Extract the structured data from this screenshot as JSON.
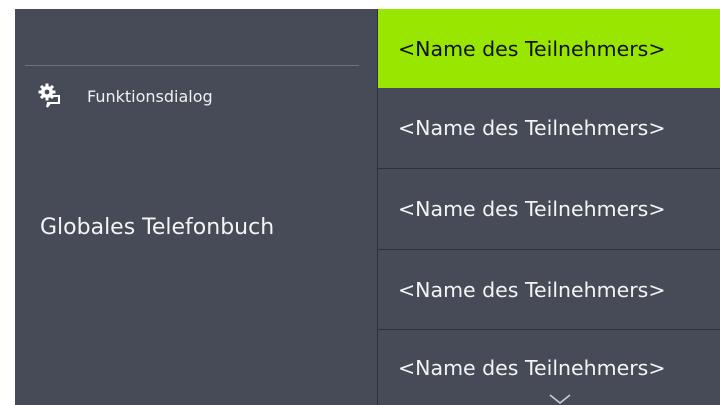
{
  "left": {
    "function_dialog_label": "Funktionsdialog",
    "page_title": "Globales Telefonbuch"
  },
  "entries": [
    {
      "label": "<Name des Teilnehmers>",
      "selected": true
    },
    {
      "label": "<Name des Teilnehmers>",
      "selected": false
    },
    {
      "label": "<Name des Teilnehmers>",
      "selected": false
    },
    {
      "label": "<Name des Teilnehmers>",
      "selected": false
    },
    {
      "label": "<Name des Teilnehmers>",
      "selected": false
    }
  ],
  "icons": {
    "function_dialog": "gear-speech-bubble-icon",
    "scroll_down": "chevron-down-icon"
  },
  "colors": {
    "background": "#464b57",
    "selected": "#99e600",
    "text": "#f2f4f6"
  }
}
